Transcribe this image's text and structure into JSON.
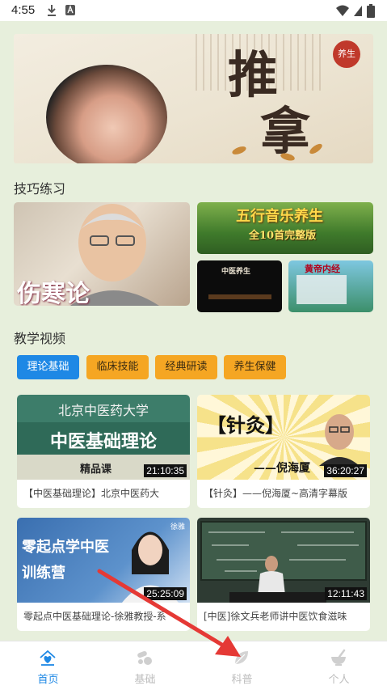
{
  "status_bar": {
    "time": "4:55"
  },
  "banner": {
    "title_char_1": "推",
    "title_char_2": "拿",
    "seal_text": "养生"
  },
  "skills_section": {
    "title": "技巧练习",
    "tiles": [
      {
        "text": "伤寒论"
      },
      {
        "text": "五行音乐养生",
        "subtext": "全10首完整版"
      },
      {
        "text": "中医养生"
      },
      {
        "text": "黄帝内经"
      }
    ]
  },
  "videos_section": {
    "title": "教学视频",
    "tabs": [
      {
        "label": "理论基础",
        "active": true
      },
      {
        "label": "临床技能",
        "active": false
      },
      {
        "label": "经典研读",
        "active": false
      },
      {
        "label": "养生保健",
        "active": false
      }
    ],
    "videos": [
      {
        "thumb_line1": "北京中医药大学",
        "thumb_line2": "中医基础理论",
        "thumb_line3": "精品课",
        "duration": "21:10:35",
        "caption": "【中医基础理论】北京中医药大"
      },
      {
        "thumb_line1": "【针灸】",
        "thumb_line2": "——倪海厦",
        "duration": "36:20:27",
        "caption": "【针灸】——倪海厦~高清字幕版"
      },
      {
        "thumb_line1": "零起点学中医",
        "thumb_line2": "训练营",
        "thumb_line3": "徐雅",
        "duration": "25:25:09",
        "caption": "零起点中医基础理论-徐雅教授-系"
      },
      {
        "duration": "12:11:43",
        "caption": "[中医]徐文兵老师讲中医饮食滋味"
      }
    ]
  },
  "navbar": {
    "items": [
      {
        "label": "首页",
        "icon": "home-heart-icon",
        "active": true
      },
      {
        "label": "基础",
        "icon": "pills-icon",
        "active": false
      },
      {
        "label": "科普",
        "icon": "leaf-icon",
        "active": false
      },
      {
        "label": "个人",
        "icon": "mortar-icon",
        "active": false
      }
    ]
  },
  "colors": {
    "accent": "#1e88e5",
    "tab_inactive": "#f5a623",
    "background": "#e7efdc",
    "arrow": "#e53935"
  }
}
